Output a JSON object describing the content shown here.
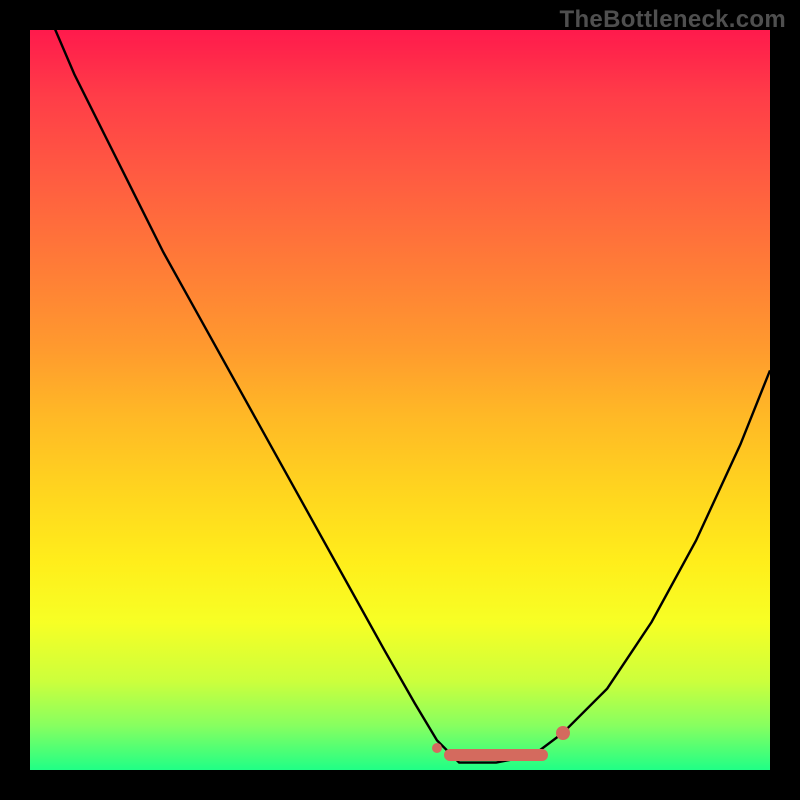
{
  "watermark": "TheBottleneck.com",
  "colors": {
    "background": "#000000",
    "curve": "#000000",
    "marker": "#d46a5e",
    "gradient_top": "#ff1a4c",
    "gradient_bottom": "#20ff86"
  },
  "chart_data": {
    "type": "line",
    "title": "",
    "xlabel": "",
    "ylabel": "",
    "xlim": [
      0,
      100
    ],
    "ylim": [
      0,
      100
    ],
    "grid": false,
    "series": [
      {
        "name": "curve",
        "x": [
          0,
          3,
          6,
          10,
          14,
          18,
          23,
          28,
          33,
          38,
          43,
          48,
          52,
          55,
          58,
          63,
          68,
          72,
          78,
          84,
          90,
          96,
          100
        ],
        "y": [
          108,
          101,
          94,
          86,
          78,
          70,
          61,
          52,
          43,
          34,
          25,
          16,
          9,
          4,
          1,
          1,
          2,
          5,
          11,
          20,
          31,
          44,
          54
        ]
      }
    ],
    "markers": {
      "start_dot": {
        "x": 55,
        "y": 3
      },
      "flat_segment": {
        "x0": 56,
        "x1": 70,
        "y": 2
      },
      "end_dot": {
        "x": 72,
        "y": 5
      }
    }
  }
}
